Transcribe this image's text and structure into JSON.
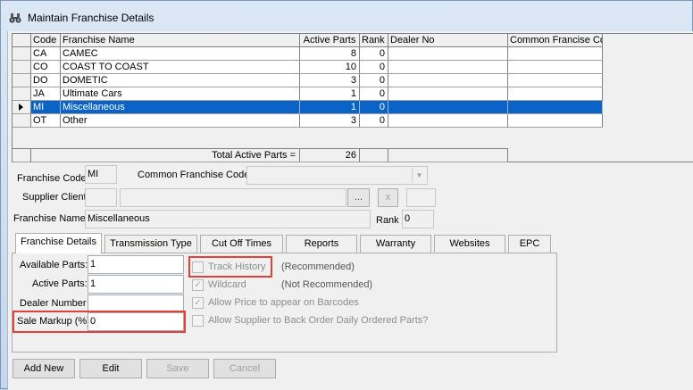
{
  "window": {
    "title": "Maintain Franchise Details",
    "icon": "binoculars-icon"
  },
  "grid": {
    "columns": [
      "Code",
      "Franchise Name",
      "Active Parts",
      "Rank",
      "Dealer No",
      "Common Francise Cd"
    ],
    "rows": [
      {
        "code": "CA",
        "name": "CAMEC",
        "active": "8",
        "rank": "0",
        "dealer": "",
        "common": ""
      },
      {
        "code": "CO",
        "name": "COAST TO COAST",
        "active": "10",
        "rank": "0",
        "dealer": "",
        "common": ""
      },
      {
        "code": "DO",
        "name": "DOMETIC",
        "active": "3",
        "rank": "0",
        "dealer": "",
        "common": ""
      },
      {
        "code": "JA",
        "name": "Ultimate Cars",
        "active": "1",
        "rank": "0",
        "dealer": "",
        "common": ""
      },
      {
        "code": "MI",
        "name": "Miscellaneous",
        "active": "1",
        "rank": "0",
        "dealer": "",
        "common": ""
      },
      {
        "code": "OT",
        "name": "Other",
        "active": "3",
        "rank": "0",
        "dealer": "",
        "common": ""
      }
    ],
    "selected_index": 4,
    "total_label": "Total Active Parts =",
    "total_value": "26"
  },
  "form": {
    "franchise_code_label": "Franchise Code",
    "franchise_code": "MI",
    "common_code_label": "Common Franchise Code",
    "common_code": "",
    "supplier_client_label": "Supplier Client",
    "browse_label": "...",
    "clear_label": "x",
    "franchise_name_label": "Franchise Name",
    "franchise_name": "Miscellaneous",
    "rank_label": "Rank",
    "rank": "0"
  },
  "tabs": [
    "Franchise Details",
    "Transmission Type",
    "Cut Off Times",
    "Reports",
    "Warranty",
    "Websites",
    "EPC"
  ],
  "active_tab": 0,
  "details": {
    "available_label": "Available Parts:",
    "available": "1",
    "active_label": "Active Parts:",
    "active": "1",
    "dealer_label": "Dealer Number",
    "dealer": "",
    "markup_label": "Sale Markup (%)",
    "markup": "0",
    "track_history": "Track History",
    "track_note": "(Recommended)",
    "wildcard": "Wildcard",
    "wildcard_note": "(Not Recommended)",
    "allow_price": "Allow Price to appear on Barcodes",
    "allow_backorder": "Allow Supplier to Back Order Daily Ordered Parts?",
    "checked": {
      "track_history": false,
      "wildcard": true,
      "allow_price": true,
      "allow_backorder": false
    }
  },
  "buttons": {
    "add": "Add New",
    "edit": "Edit",
    "save": "Save",
    "cancel": "Cancel"
  },
  "colors": {
    "selection": "#0a64c8",
    "highlight": "#e0413a"
  }
}
